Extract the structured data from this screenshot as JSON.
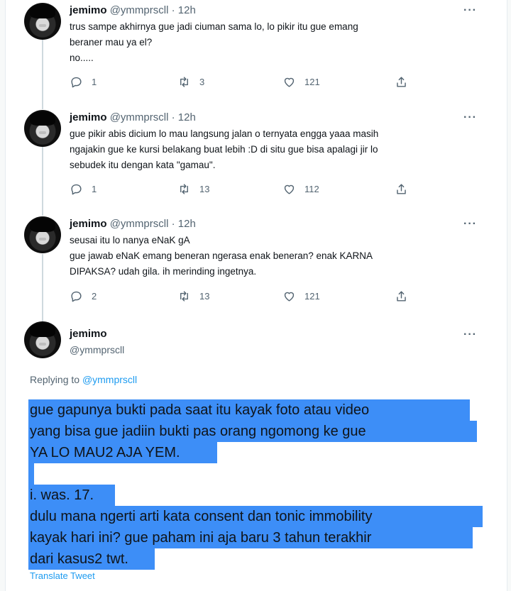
{
  "tweets": [
    {
      "name": "jemimo",
      "handle": "@ymmprscll",
      "dot": "·",
      "time": "12h",
      "text": "trus sampe akhirnya gue jadi ciuman sama lo, lo pikir itu gue emang\nberaner mau ya el?\nno.....",
      "replies": "1",
      "retweets": "3",
      "likes": "121"
    },
    {
      "name": "jemimo",
      "handle": "@ymmprscll",
      "dot": "·",
      "time": "12h",
      "text": "gue pikir abis dicium lo mau langsung jalan o ternyata engga yaaa masih\nngajakin gue ke kursi belakang buat lebih :D di situ gue bisa apalagi jir lo\nsebudek itu dengan kata \"gamau\".",
      "replies": "1",
      "retweets": "13",
      "likes": "112"
    },
    {
      "name": "jemimo",
      "handle": "@ymmprscll",
      "dot": "·",
      "time": "12h",
      "text": "seusai itu lo nanya eNaK gA\ngue jawab eNaK emang beneran ngerasa enak beneran? enak KARNA\nDIPAKSA? udah gila. ih merinding ingetnya.",
      "replies": "2",
      "retweets": "13",
      "likes": "121"
    }
  ],
  "main_tweet": {
    "name": "jemimo",
    "handle": "@ymmprscll",
    "replying_label": "Replying to",
    "replying_to": "@ymmprscll",
    "lines": [
      "gue gapunya bukti pada saat itu kayak foto atau video",
      "yang bisa gue jadiin bukti pas orang ngomong ke gue",
      "YA LO MAU2 AJA YEM.",
      "",
      "i. was. 17.",
      "dulu mana ngerti arti kata consent dan tonic immobility",
      "kayak hari ini? gue paham ini aja baru 3 tahun terakhir",
      "dari kasus2 twt."
    ],
    "translate_label": "Translate Tweet"
  },
  "icons": {
    "more": "more-dots-icon",
    "reply": "reply-icon",
    "retweet": "retweet-icon",
    "like": "heart-icon",
    "share": "share-icon"
  },
  "colors": {
    "highlight": "#3d8ef7",
    "link": "#1d9bf0",
    "muted": "#536471"
  }
}
